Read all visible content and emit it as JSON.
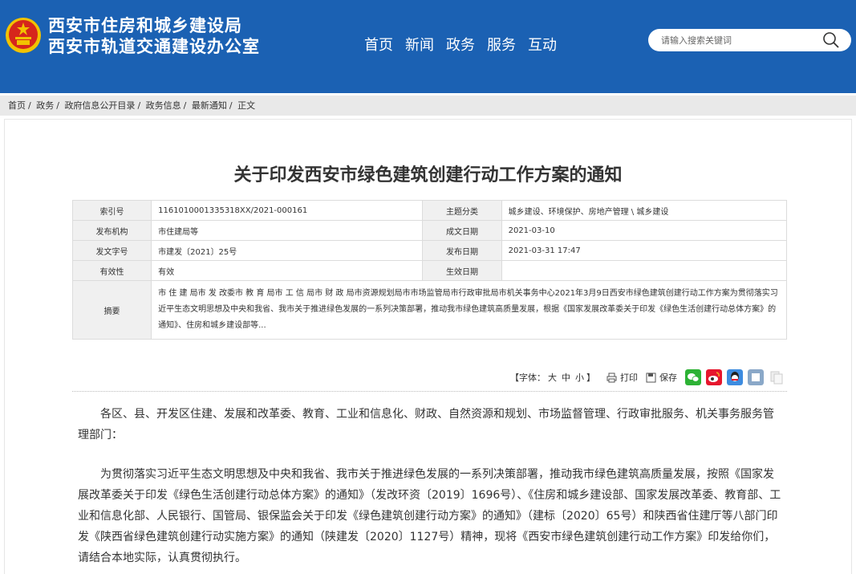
{
  "header": {
    "title_line1": "西安市住房和城乡建设局",
    "title_line2": "西安市轨道交通建设办公室",
    "colors": {
      "header_bg": "#1b61b3",
      "emblem_red": "#d6261c",
      "emblem_gold": "#f2c200"
    },
    "nav": [
      "首页",
      "新闻",
      "政务",
      "服务",
      "互动"
    ],
    "search_placeholder": "请输入搜索关键词"
  },
  "breadcrumb": [
    "首页",
    "政务",
    "政府信息公开目录",
    "政务信息",
    "最新通知",
    "正文"
  ],
  "breadcrumb_sep": "/",
  "doc": {
    "title": "关于印发西安市绿色建筑创建行动工作方案的通知",
    "meta": {
      "index_no_label": "索引号",
      "index_no": "1161010001335318XX/2021-000161",
      "topic_label": "主题分类",
      "topic": "城乡建设、环境保护、房地产管理 \\ 城乡建设",
      "issuer_label": "发布机构",
      "issuer": "市住建局等",
      "created_label": "成文日期",
      "created": "2021-03-10",
      "doc_no_label": "发文字号",
      "doc_no": "市建发〔2021〕25号",
      "publish_label": "发布日期",
      "publish": "2021-03-31 17:47",
      "validity_label": "有效性",
      "validity": "有效",
      "effective_label": "生效日期",
      "effective": "",
      "abstract_label": "摘要",
      "abstract": "市 住 建 局市 发 改委市 教 育 局市 工 信 局市 财 政 局市资源规划局市市场监管局市行政审批局市机关事务中心2021年3月9日西安市绿色建筑创建行动工作方案为贯彻落实习近平生态文明思想及中央和我省、我市关于推进绿色发展的一系列决策部署，推动我市绿色建筑高质量发展，根据《国家发展改革委关于印发《绿色生活创建行动总体方案》的通知》、住房和城乡建设部等..."
    },
    "tools": {
      "font_label": "【字体：",
      "font_large": "大",
      "font_medium": "中",
      "font_small": "小",
      "font_close": "】",
      "print": "打印",
      "save": "保存"
    },
    "share_icons": [
      "wechat-icon",
      "weibo-icon",
      "qq-icon",
      "qzone-icon",
      "copy-icon"
    ],
    "para1": "各区、县、开发区住建、发展和改革委、教育、工业和信息化、财政、自然资源和规划、市场监督管理、行政审批服务、机关事务服务管理部门：",
    "para2": "为贯彻落实习近平生态文明思想及中央和我省、我市关于推进绿色发展的一系列决策部署，推动我市绿色建筑高质量发展，按照《国家发展改革委关于印发《绿色生活创建行动总体方案》的通知》（发改环资〔2019〕1696号）、《住房和城乡建设部、国家发展改革委、教育部、工业和信息化部、人民银行、国管局、银保监会关于印发《绿色建筑创建行动方案》的通知》（建标〔2020〕65号）和陕西省住建厅等八部门印发《陕西省绿色建筑创建行动实施方案》的通知（陕建发〔2020〕1127号）精神，现将《西安市绿色建筑创建行动工作方案》印发给你们，请结合本地实际，认真贯彻执行。"
  }
}
